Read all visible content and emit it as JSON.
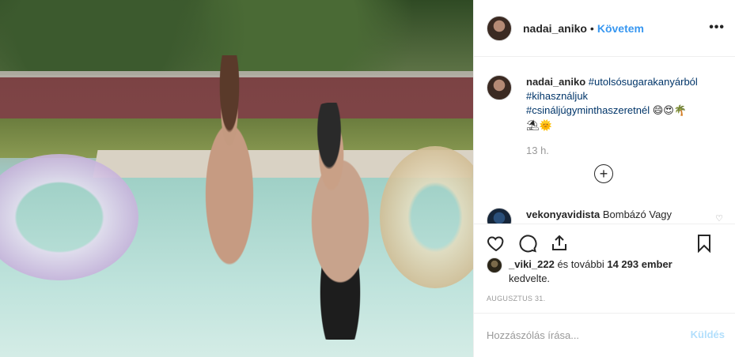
{
  "post": {
    "username": "nadai_aniko",
    "follow_label": "Követem",
    "separator": "•",
    "more_label": "•••"
  },
  "caption": {
    "username": "nadai_aniko",
    "hashtags": [
      "#utolsósugarakanyárból",
      "#kihasználjuk",
      "#csináljúgyminthaszeretnél"
    ],
    "emojis_line1": "😄😍🌴",
    "emojis_line2": "⛱🌞",
    "time": "13 h."
  },
  "load_more": {
    "icon": "plus-circle-icon",
    "label": "+"
  },
  "comments": [
    {
      "username": "vekonyavidista",
      "text": "Bombázó Vagy"
    }
  ],
  "actions": {
    "icons": [
      "heart-icon",
      "comment-icon",
      "share-icon",
      "bookmark-icon"
    ]
  },
  "likes": {
    "username": "_viki_222",
    "text_middle": " és további ",
    "count": "14 293 ember",
    "text_end": "kedvelte."
  },
  "date": "AUGUSZTUS 31.",
  "add_comment": {
    "placeholder": "Hozzászólás írása...",
    "post_label": "Küldés"
  },
  "colors": {
    "accent": "#3897f0",
    "hashtag": "#003569",
    "muted": "#999999",
    "post_disabled": "#b2dffc"
  }
}
